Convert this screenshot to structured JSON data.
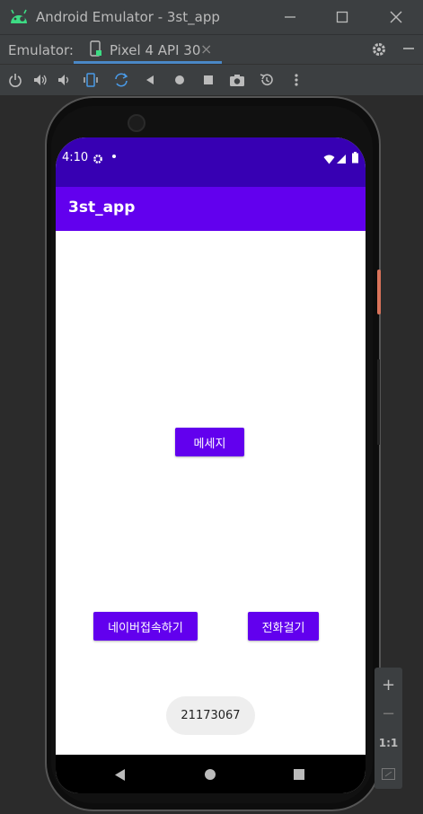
{
  "window": {
    "title": "Android Emulator - 3st_app"
  },
  "tabbar": {
    "label": "Emulator:",
    "tab_label": "Pixel 4 API 30",
    "tab_close": "×"
  },
  "toolbar": {
    "icons": [
      "power-icon",
      "volume-up-icon",
      "volume-down-icon",
      "rotate-left-icon",
      "rotate-right-icon",
      "back-icon",
      "home-icon",
      "overview-icon",
      "camera-icon",
      "replay-icon",
      "more-icon"
    ]
  },
  "status_bar": {
    "time": "4:10"
  },
  "app_bar": {
    "title": "3st_app"
  },
  "buttons": {
    "message": "메세지",
    "naver": "네이버접속하기",
    "call": "전화걸기"
  },
  "toast": {
    "text": "21173067"
  },
  "zoom": {
    "plus": "+",
    "minus": "−",
    "ratio": "1:1"
  },
  "colors": {
    "status_bar": "#3700b3",
    "app_bar": "#6200ee",
    "button": "#6200ee"
  }
}
